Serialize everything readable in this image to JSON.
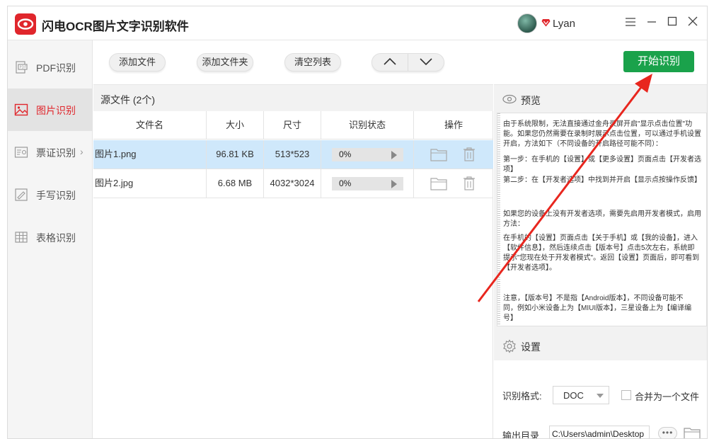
{
  "app": {
    "title": "闪电OCR图片文字识别软件",
    "username": "Lyan",
    "brand_color": "#e0262c",
    "accent_green": "#1aa24b"
  },
  "window_controls": {
    "menu_icon": "menu-icon",
    "minimize": "—",
    "maximize": "☐",
    "close": "✕"
  },
  "sidebar": {
    "items": [
      {
        "label": "PDF识别",
        "icon": "pdf-icon"
      },
      {
        "label": "图片识别",
        "icon": "image-icon",
        "active": true
      },
      {
        "label": "票证识别",
        "icon": "ticket-icon"
      },
      {
        "label": "手写识别",
        "icon": "handwriting-icon"
      },
      {
        "label": "表格识别",
        "icon": "table-icon"
      }
    ]
  },
  "toolbar": {
    "add_file": "添加文件",
    "add_folder": "添加文件夹",
    "clear_list": "清空列表",
    "start": "开始识别"
  },
  "file_list": {
    "title": "源文件 (2个)",
    "columns": [
      "文件名",
      "大小",
      "尺寸",
      "识别状态",
      "操作"
    ],
    "rows": [
      {
        "name": "图片1.png",
        "size": "96.81 KB",
        "dims": "513*523",
        "progress": "0%"
      },
      {
        "name": "图片2.jpg",
        "size": "6.68 MB",
        "dims": "4032*3024",
        "progress": "0%"
      }
    ]
  },
  "preview": {
    "title": "预览",
    "lines": [
      "由于系统限制，无法直接通过金舟录屏开启\"显示点击位置\"功",
      "能。如果您仍然需要在录制时展示点击位置，可以通过手机设置",
      "开启，方法如下（不同设备的开启路径可能不同）：",
      "第一步：在手机的【设置】或【更多设置】页面点击【开发者选",
      "项】",
      "第二步：在【开发者选项】中找到并开启【显示点按操作反馈】",
      "如果您的设备上没有开发者选项，需要先启用开发者模式，启用",
      "方法：",
      "在手机的【设置】页面点击【关于手机】或【我的设备】，进入",
      "【软件信息】，然后连续点击【版本号】点击5次左右，系统即",
      "提示\"您现在处于开发者模式\"。返回【设置】页面后，即可看到",
      "【开发者选项】。",
      "注意，【版本号】不是指【Android版本】，不同设备可能不",
      "同，例如小米设备上为【MIUI版本】，三星设备上为【编译编",
      "号】"
    ]
  },
  "settings": {
    "title": "设置",
    "format_label": "识别格式:",
    "format_value": "DOC",
    "merge_label": "合并为一个文件",
    "output_label": "输出目录",
    "output_value": "C:\\Users\\admin\\Desktop",
    "more": "•••"
  }
}
